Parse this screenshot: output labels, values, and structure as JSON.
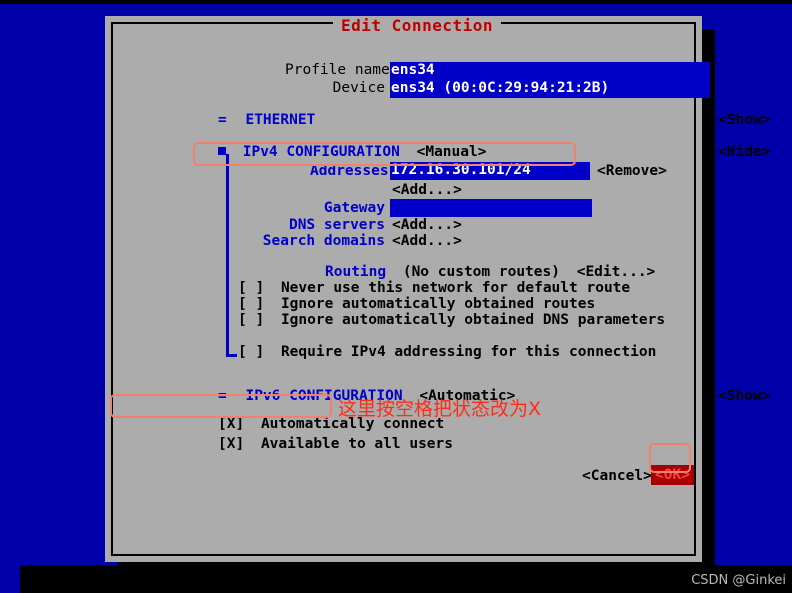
{
  "window": {
    "title": "Edit Connection",
    "app": "nmtui",
    "colors": {
      "terminal_background": "#0000A8",
      "dialog_background": "#ACACAC",
      "label_blue": "#0000C8",
      "field_background": "#0000C8",
      "field_text": "#FFFFFF",
      "title_red": "#C00000",
      "annotation_red": "#FF2D18",
      "annotation_box": "#F08070",
      "ok_button_background": "#A80000",
      "ok_button_text": "#FF4040"
    }
  },
  "form": {
    "profile_name": {
      "label": "Profile name",
      "value": "ens34"
    },
    "device": {
      "label": "Device",
      "value": "ens34 (00:0C:29:94:21:2B)"
    }
  },
  "sections": {
    "ethernet": {
      "marker": "=",
      "label": "ETHERNET",
      "toggle": "<Show>"
    },
    "ipv4": {
      "marker": "square",
      "label": "IPv4 CONFIGURATION",
      "mode": "<Manual>",
      "toggle": "<Hide>",
      "addresses": {
        "label": "Addresses",
        "value": "172.16.30.101/24",
        "remove_label": "<Remove>",
        "add_label": "<Add...>"
      },
      "gateway": {
        "label": "Gateway",
        "value": ""
      },
      "dns_servers": {
        "label": "DNS servers",
        "add_label": "<Add...>"
      },
      "search_domains": {
        "label": "Search domains",
        "add_label": "<Add...>"
      },
      "routing": {
        "label": "Routing",
        "value": "(No custom routes)",
        "edit_label": "<Edit...>"
      },
      "checkboxes": [
        {
          "state": "[ ]",
          "label": "Never use this network for default route"
        },
        {
          "state": "[ ]",
          "label": "Ignore automatically obtained routes"
        },
        {
          "state": "[ ]",
          "label": "Ignore automatically obtained DNS parameters"
        },
        {
          "state": "[ ]",
          "label": "Require IPv4 addressing for this connection"
        }
      ]
    },
    "ipv6": {
      "marker": "=",
      "label": "IPv6 CONFIGURATION",
      "mode": "<Automatic>",
      "toggle": "<Show>"
    }
  },
  "options": [
    {
      "state": "[X]",
      "label": "Automatically connect"
    },
    {
      "state": "[X]",
      "label": "Available to all users"
    }
  ],
  "buttons": {
    "cancel": "<Cancel>",
    "ok": "<OK>"
  },
  "annotations": {
    "note_cn": "这里按空格把状态改为X"
  },
  "watermark": {
    "text": "CSDN @Ginkei"
  }
}
